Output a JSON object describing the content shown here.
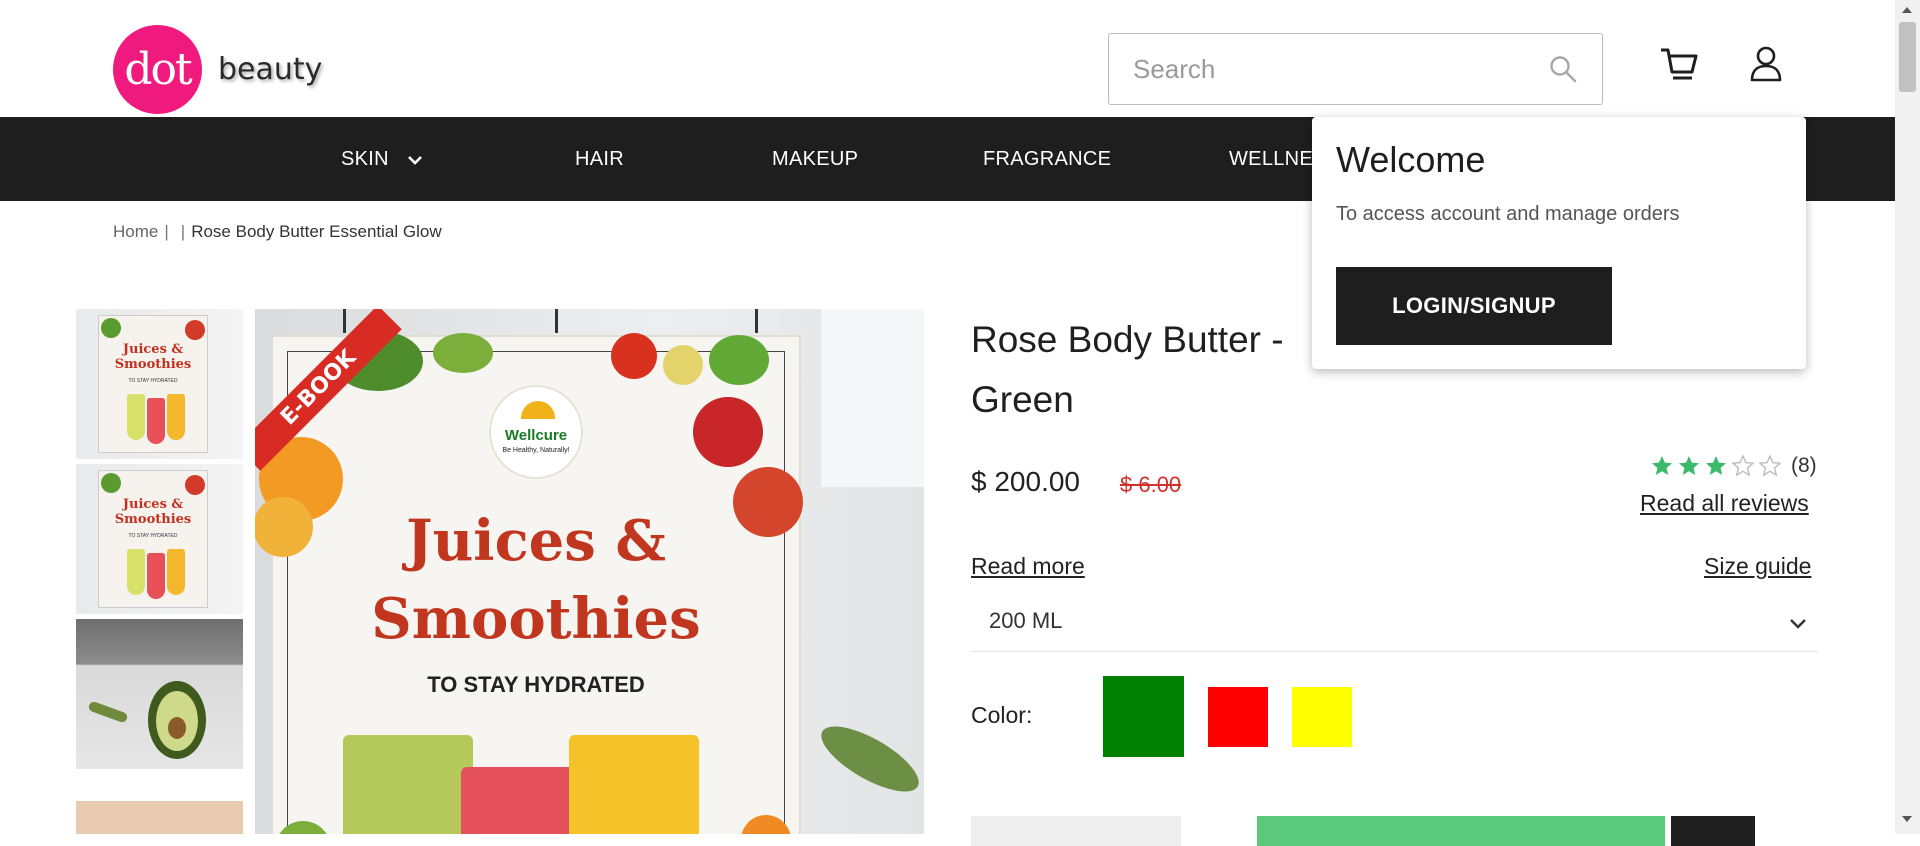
{
  "brand": {
    "logo_mark": "dot",
    "name": "beauty"
  },
  "search": {
    "placeholder": "Search",
    "value": ""
  },
  "nav": {
    "items": [
      {
        "label": "SKIN",
        "has_dropdown": true
      },
      {
        "label": "HAIR"
      },
      {
        "label": "MAKEUP"
      },
      {
        "label": "FRAGRANCE"
      },
      {
        "label": "WELLNE"
      }
    ]
  },
  "breadcrumb": {
    "home": "Home",
    "sep1": "|",
    "sep2": "|",
    "current": "Rose Body Butter Essential Glow"
  },
  "thumbnails": {
    "items": [
      {
        "title": "Juices & Smoothies",
        "sub": "TO STAY HYDRATED",
        "kind": "ebook-cover"
      },
      {
        "title": "Juices & Smoothies",
        "sub": "TO STAY HYDRATED",
        "kind": "ebook-cover"
      },
      {
        "kind": "avocado-photo"
      }
    ]
  },
  "main_image": {
    "ribbon": "E-BOOK",
    "badge_name": "Wellcure",
    "badge_tagline": "Be Healthy, Naturally!",
    "title_line1": "Juices &",
    "title_line2": "Smoothies",
    "subtitle": "TO STAY HYDRATED"
  },
  "product": {
    "title_line1": "Rose Body Butter -",
    "title_line2": "Green",
    "price": "$ 200.00",
    "old_price": "$ 6.00",
    "rating": {
      "value": 3,
      "max": 5,
      "count": "(8)"
    },
    "read_all_reviews": "Read all reviews",
    "read_more": "Read more",
    "size_guide": "Size guide",
    "size_selected": "200 ML",
    "color_label": "Color:",
    "colors": [
      "#008000",
      "#ff0000",
      "#ffff00"
    ],
    "selected_color": "#008000"
  },
  "popup": {
    "title": "Welcome",
    "text": "To access account and manage orders",
    "button": "LOGIN/SIGNUP"
  },
  "colors": {
    "brand_pink": "#f0197d",
    "nav_bg": "#1e1e1e",
    "star_filled": "#3cb96a",
    "add_to_cart": "#5ac97c",
    "old_price": "#d0312d"
  }
}
